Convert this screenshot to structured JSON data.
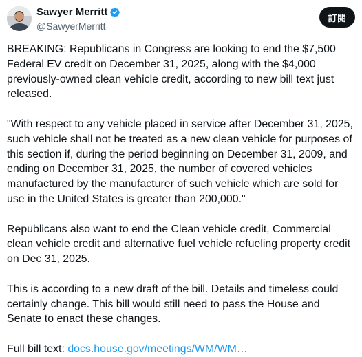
{
  "author": {
    "display_name": "Sawyer Merritt",
    "handle": "@SawyerMerritt",
    "verified_icon": "verified-badge-icon",
    "avatar_icon": "avatar-photo"
  },
  "subscribe_label": "訂閱",
  "tweet": {
    "paragraphs": [
      "BREAKING: Republicans in Congress are looking to end the $7,500 Federal EV credit on December 31, 2025, along with the $4,000 previously-owned clean vehicle credit, according to new bill text just released.",
      "\"With respect to any vehicle placed in service after December 31, 2025, such vehicle shall not be treated as a new clean vehicle for purposes of this section if, during the period beginning on December 31, 2009, and ending on December 31, 2025, the number of covered vehicles manufactured by the manufacturer of such vehicle which are sold for use in the United States is greater than 200,000.\"",
      "Republicans also want to end the Clean vehicle credit, Commercial clean vehicle credit and alternative fuel vehicle refueling property credit on Dec 31, 2025.",
      "This is according to a new draft of the bill. Details and timeless could certainly change. This bill would still need to pass the House and Senate to enact these changes."
    ],
    "last_prefix": "Full bill text: ",
    "link_text": "docs.house.gov/meetings/WM/WM…"
  },
  "colors": {
    "text": "#0f1419",
    "secondary": "#536471",
    "link": "#1d9bf0",
    "verified": "#1d9bf0",
    "button_bg": "#0f1419"
  }
}
